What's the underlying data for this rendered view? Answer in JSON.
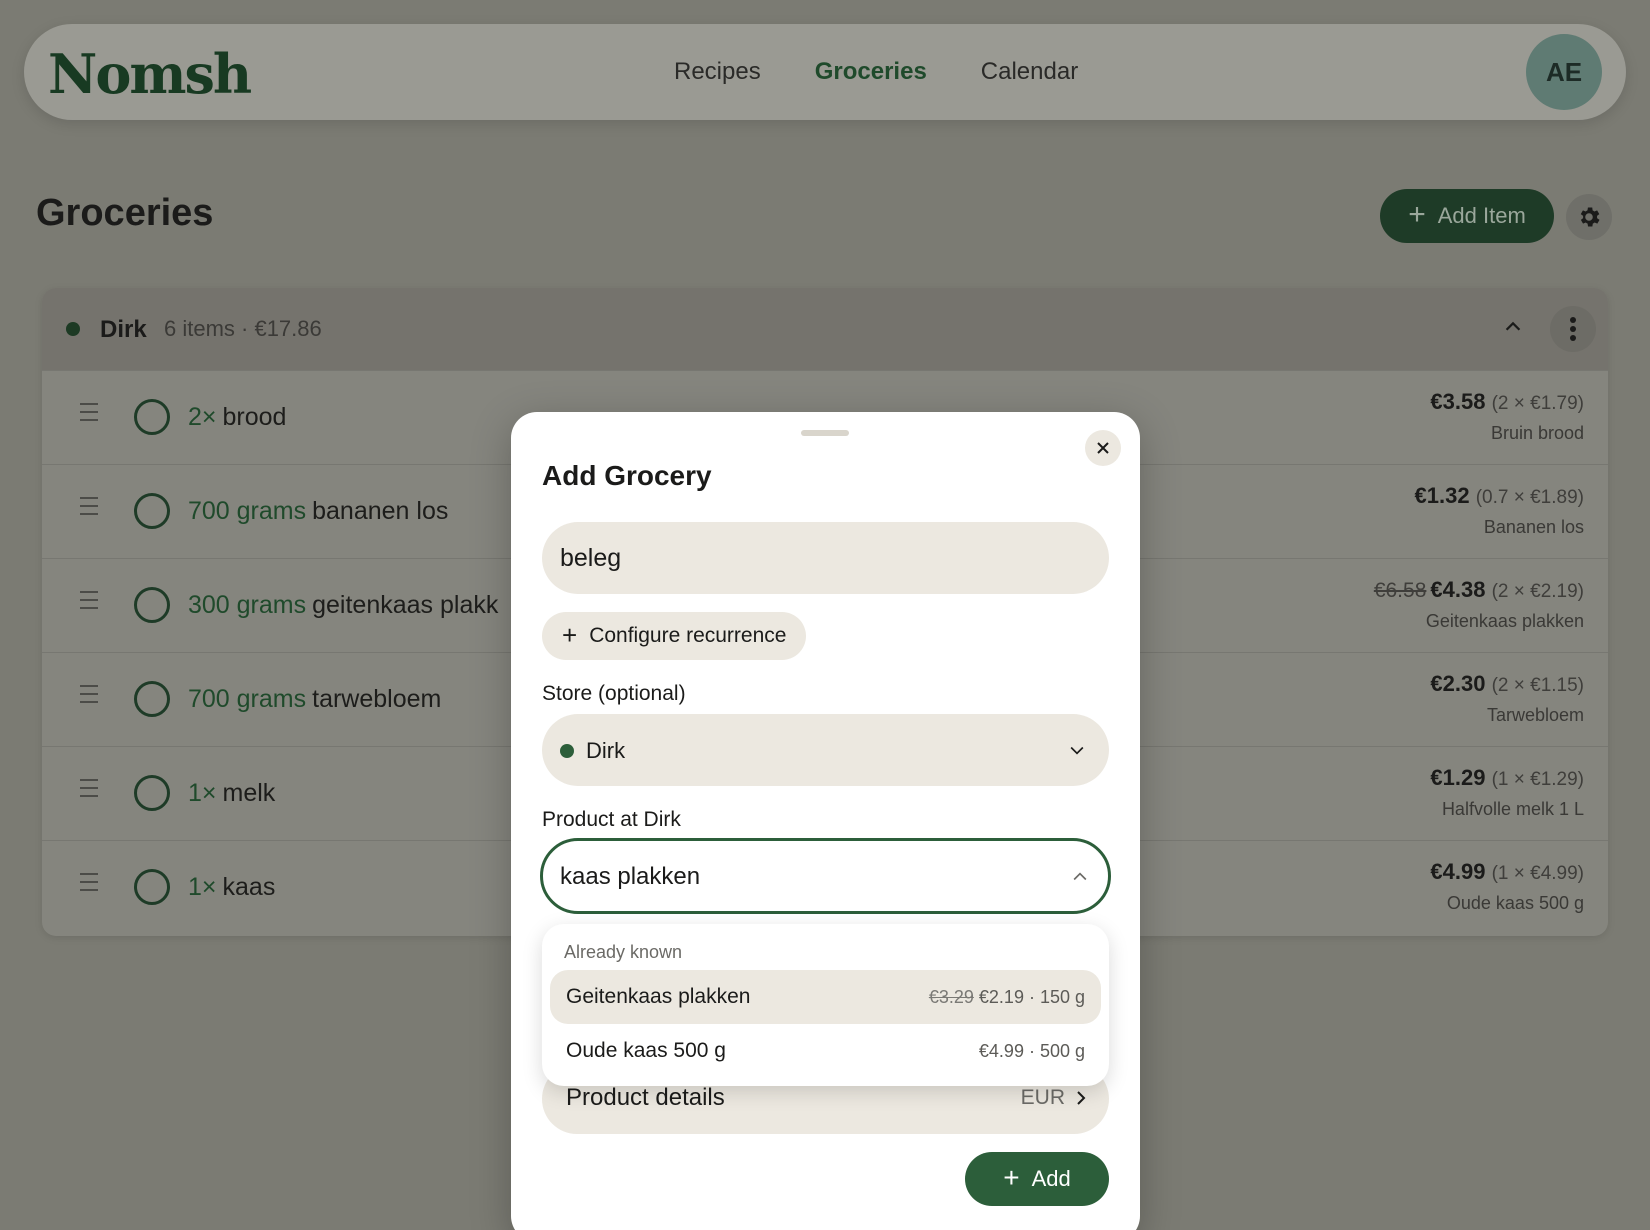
{
  "nav": {
    "logo": "Nomsh",
    "links": [
      "Recipes",
      "Groceries",
      "Calendar"
    ],
    "active": "Groceries",
    "avatar": "AE"
  },
  "page": {
    "title": "Groceries",
    "add_item_label": "Add Item"
  },
  "store_group": {
    "name": "Dirk",
    "meta": "6 items · €17.86",
    "items": [
      {
        "qty": "2×",
        "name": "brood",
        "price": "€3.58",
        "old_price": "",
        "calc": "(2 × €1.79)",
        "product": "Bruin brood"
      },
      {
        "qty": "700 grams",
        "name": "bananen los",
        "price": "€1.32",
        "old_price": "",
        "calc": "(0.7 × €1.89)",
        "product": "Bananen los"
      },
      {
        "qty": "300 grams",
        "name": "geitenkaas plakk",
        "price": "€4.38",
        "old_price": "€6.58",
        "calc": "(2 × €2.19)",
        "product": "Geitenkaas plakken"
      },
      {
        "qty": "700 grams",
        "name": "tarwebloem",
        "price": "€2.30",
        "old_price": "",
        "calc": "(2 × €1.15)",
        "product": "Tarwebloem"
      },
      {
        "qty": "1×",
        "name": "melk",
        "price": "€1.29",
        "old_price": "",
        "calc": "(1 × €1.29)",
        "product": "Halfvolle melk 1 L"
      },
      {
        "qty": "1×",
        "name": "kaas",
        "price": "€4.99",
        "old_price": "",
        "calc": "(1 × €4.99)",
        "product": "Oude kaas 500 g"
      }
    ]
  },
  "modal": {
    "title": "Add Grocery",
    "name_value": "beleg",
    "recurrence_label": "Configure recurrence",
    "store_label": "Store (optional)",
    "store_value": "Dirk",
    "product_label": "Product at Dirk",
    "product_value": "kaas plakken",
    "details_label": "Product details",
    "details_currency": "EUR",
    "add_label": "Add"
  },
  "dropdown": {
    "section": "Already known",
    "options": [
      {
        "name": "Geitenkaas plakken",
        "old": "€3.29",
        "meta": "€2.19 · 150 g"
      },
      {
        "name": "Oude kaas 500 g",
        "old": "",
        "meta": "€4.99 · 500 g"
      }
    ]
  },
  "colors": {
    "brand_green": "#2c5e3a",
    "overlay_bg": "#7b7b73",
    "input_bg": "#ece8e0"
  }
}
